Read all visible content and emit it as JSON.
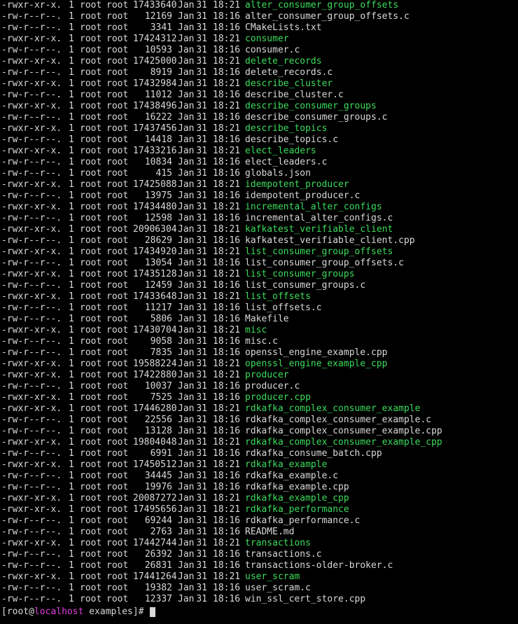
{
  "colors": {
    "background": "#000000",
    "text": "#d9d9d9",
    "executable": "#3ddc5c",
    "hostname": "#e040e0"
  },
  "listing": [
    {
      "perm": "-rwxr-xr-x.",
      "links": "1",
      "owner": "root",
      "group": "root",
      "size": "17433640",
      "month": "Jan",
      "day": "31",
      "time": "18:21",
      "name": "alter_consumer_group_offsets",
      "exec": true
    },
    {
      "perm": "-rw-r--r--.",
      "links": "1",
      "owner": "root",
      "group": "root",
      "size": "12169",
      "month": "Jan",
      "day": "31",
      "time": "18:16",
      "name": "alter_consumer_group_offsets.c",
      "exec": false
    },
    {
      "perm": "-rw-r--r--.",
      "links": "1",
      "owner": "root",
      "group": "root",
      "size": "3341",
      "month": "Jan",
      "day": "31",
      "time": "18:16",
      "name": "CMakeLists.txt",
      "exec": false
    },
    {
      "perm": "-rwxr-xr-x.",
      "links": "1",
      "owner": "root",
      "group": "root",
      "size": "17424312",
      "month": "Jan",
      "day": "31",
      "time": "18:21",
      "name": "consumer",
      "exec": true
    },
    {
      "perm": "-rw-r--r--.",
      "links": "1",
      "owner": "root",
      "group": "root",
      "size": "10593",
      "month": "Jan",
      "day": "31",
      "time": "18:16",
      "name": "consumer.c",
      "exec": false
    },
    {
      "perm": "-rwxr-xr-x.",
      "links": "1",
      "owner": "root",
      "group": "root",
      "size": "17425000",
      "month": "Jan",
      "day": "31",
      "time": "18:21",
      "name": "delete_records",
      "exec": true
    },
    {
      "perm": "-rw-r--r--.",
      "links": "1",
      "owner": "root",
      "group": "root",
      "size": "8919",
      "month": "Jan",
      "day": "31",
      "time": "18:16",
      "name": "delete_records.c",
      "exec": false
    },
    {
      "perm": "-rwxr-xr-x.",
      "links": "1",
      "owner": "root",
      "group": "root",
      "size": "17432984",
      "month": "Jan",
      "day": "31",
      "time": "18:21",
      "name": "describe_cluster",
      "exec": true
    },
    {
      "perm": "-rw-r--r--.",
      "links": "1",
      "owner": "root",
      "group": "root",
      "size": "11012",
      "month": "Jan",
      "day": "31",
      "time": "18:16",
      "name": "describe_cluster.c",
      "exec": false
    },
    {
      "perm": "-rwxr-xr-x.",
      "links": "1",
      "owner": "root",
      "group": "root",
      "size": "17438496",
      "month": "Jan",
      "day": "31",
      "time": "18:21",
      "name": "describe_consumer_groups",
      "exec": true
    },
    {
      "perm": "-rw-r--r--.",
      "links": "1",
      "owner": "root",
      "group": "root",
      "size": "16222",
      "month": "Jan",
      "day": "31",
      "time": "18:16",
      "name": "describe_consumer_groups.c",
      "exec": false
    },
    {
      "perm": "-rwxr-xr-x.",
      "links": "1",
      "owner": "root",
      "group": "root",
      "size": "17437456",
      "month": "Jan",
      "day": "31",
      "time": "18:21",
      "name": "describe_topics",
      "exec": true
    },
    {
      "perm": "-rw-r--r--.",
      "links": "1",
      "owner": "root",
      "group": "root",
      "size": "14418",
      "month": "Jan",
      "day": "31",
      "time": "18:16",
      "name": "describe_topics.c",
      "exec": false
    },
    {
      "perm": "-rwxr-xr-x.",
      "links": "1",
      "owner": "root",
      "group": "root",
      "size": "17433216",
      "month": "Jan",
      "day": "31",
      "time": "18:21",
      "name": "elect_leaders",
      "exec": true
    },
    {
      "perm": "-rw-r--r--.",
      "links": "1",
      "owner": "root",
      "group": "root",
      "size": "10834",
      "month": "Jan",
      "day": "31",
      "time": "18:16",
      "name": "elect_leaders.c",
      "exec": false
    },
    {
      "perm": "-rw-r--r--.",
      "links": "1",
      "owner": "root",
      "group": "root",
      "size": "415",
      "month": "Jan",
      "day": "31",
      "time": "18:16",
      "name": "globals.json",
      "exec": false
    },
    {
      "perm": "-rwxr-xr-x.",
      "links": "1",
      "owner": "root",
      "group": "root",
      "size": "17425088",
      "month": "Jan",
      "day": "31",
      "time": "18:21",
      "name": "idempotent_producer",
      "exec": true
    },
    {
      "perm": "-rw-r--r--.",
      "links": "1",
      "owner": "root",
      "group": "root",
      "size": "13975",
      "month": "Jan",
      "day": "31",
      "time": "18:16",
      "name": "idempotent_producer.c",
      "exec": false
    },
    {
      "perm": "-rwxr-xr-x.",
      "links": "1",
      "owner": "root",
      "group": "root",
      "size": "17434480",
      "month": "Jan",
      "day": "31",
      "time": "18:21",
      "name": "incremental_alter_configs",
      "exec": true
    },
    {
      "perm": "-rw-r--r--.",
      "links": "1",
      "owner": "root",
      "group": "root",
      "size": "12598",
      "month": "Jan",
      "day": "31",
      "time": "18:16",
      "name": "incremental_alter_configs.c",
      "exec": false
    },
    {
      "perm": "-rwxr-xr-x.",
      "links": "1",
      "owner": "root",
      "group": "root",
      "size": "20906304",
      "month": "Jan",
      "day": "31",
      "time": "18:21",
      "name": "kafkatest_verifiable_client",
      "exec": true
    },
    {
      "perm": "-rw-r--r--.",
      "links": "1",
      "owner": "root",
      "group": "root",
      "size": "28629",
      "month": "Jan",
      "day": "31",
      "time": "18:16",
      "name": "kafkatest_verifiable_client.cpp",
      "exec": false
    },
    {
      "perm": "-rwxr-xr-x.",
      "links": "1",
      "owner": "root",
      "group": "root",
      "size": "17434920",
      "month": "Jan",
      "day": "31",
      "time": "18:21",
      "name": "list_consumer_group_offsets",
      "exec": true
    },
    {
      "perm": "-rw-r--r--.",
      "links": "1",
      "owner": "root",
      "group": "root",
      "size": "13054",
      "month": "Jan",
      "day": "31",
      "time": "18:16",
      "name": "list_consumer_group_offsets.c",
      "exec": false
    },
    {
      "perm": "-rwxr-xr-x.",
      "links": "1",
      "owner": "root",
      "group": "root",
      "size": "17435128",
      "month": "Jan",
      "day": "31",
      "time": "18:21",
      "name": "list_consumer_groups",
      "exec": true
    },
    {
      "perm": "-rw-r--r--.",
      "links": "1",
      "owner": "root",
      "group": "root",
      "size": "12459",
      "month": "Jan",
      "day": "31",
      "time": "18:16",
      "name": "list_consumer_groups.c",
      "exec": false
    },
    {
      "perm": "-rwxr-xr-x.",
      "links": "1",
      "owner": "root",
      "group": "root",
      "size": "17433648",
      "month": "Jan",
      "day": "31",
      "time": "18:21",
      "name": "list_offsets",
      "exec": true
    },
    {
      "perm": "-rw-r--r--.",
      "links": "1",
      "owner": "root",
      "group": "root",
      "size": "11217",
      "month": "Jan",
      "day": "31",
      "time": "18:16",
      "name": "list_offsets.c",
      "exec": false
    },
    {
      "perm": "-rw-r--r--.",
      "links": "1",
      "owner": "root",
      "group": "root",
      "size": "5806",
      "month": "Jan",
      "day": "31",
      "time": "18:16",
      "name": "Makefile",
      "exec": false
    },
    {
      "perm": "-rwxr-xr-x.",
      "links": "1",
      "owner": "root",
      "group": "root",
      "size": "17430704",
      "month": "Jan",
      "day": "31",
      "time": "18:21",
      "name": "misc",
      "exec": true
    },
    {
      "perm": "-rw-r--r--.",
      "links": "1",
      "owner": "root",
      "group": "root",
      "size": "9058",
      "month": "Jan",
      "day": "31",
      "time": "18:16",
      "name": "misc.c",
      "exec": false
    },
    {
      "perm": "-rw-r--r--.",
      "links": "1",
      "owner": "root",
      "group": "root",
      "size": "7835",
      "month": "Jan",
      "day": "31",
      "time": "18:16",
      "name": "openssl_engine_example.cpp",
      "exec": false
    },
    {
      "perm": "-rwxr-xr-x.",
      "links": "1",
      "owner": "root",
      "group": "root",
      "size": "19588224",
      "month": "Jan",
      "day": "31",
      "time": "18:21",
      "name": "openssl_engine_example_cpp",
      "exec": true
    },
    {
      "perm": "-rwxr-xr-x.",
      "links": "1",
      "owner": "root",
      "group": "root",
      "size": "17422880",
      "month": "Jan",
      "day": "31",
      "time": "18:21",
      "name": "producer",
      "exec": true
    },
    {
      "perm": "-rw-r--r--.",
      "links": "1",
      "owner": "root",
      "group": "root",
      "size": "10037",
      "month": "Jan",
      "day": "31",
      "time": "18:16",
      "name": "producer.c",
      "exec": false
    },
    {
      "perm": "-rwxr-xr-x.",
      "links": "1",
      "owner": "root",
      "group": "root",
      "size": "7525",
      "month": "Jan",
      "day": "31",
      "time": "18:16",
      "name": "producer.cpp",
      "exec": true
    },
    {
      "perm": "-rwxr-xr-x.",
      "links": "1",
      "owner": "root",
      "group": "root",
      "size": "17446280",
      "month": "Jan",
      "day": "31",
      "time": "18:21",
      "name": "rdkafka_complex_consumer_example",
      "exec": true
    },
    {
      "perm": "-rw-r--r--.",
      "links": "1",
      "owner": "root",
      "group": "root",
      "size": "22556",
      "month": "Jan",
      "day": "31",
      "time": "18:16",
      "name": "rdkafka_complex_consumer_example.c",
      "exec": false
    },
    {
      "perm": "-rw-r--r--.",
      "links": "1",
      "owner": "root",
      "group": "root",
      "size": "13128",
      "month": "Jan",
      "day": "31",
      "time": "18:16",
      "name": "rdkafka_complex_consumer_example.cpp",
      "exec": false
    },
    {
      "perm": "-rwxr-xr-x.",
      "links": "1",
      "owner": "root",
      "group": "root",
      "size": "19804048",
      "month": "Jan",
      "day": "31",
      "time": "18:21",
      "name": "rdkafka_complex_consumer_example_cpp",
      "exec": true
    },
    {
      "perm": "-rw-r--r--.",
      "links": "1",
      "owner": "root",
      "group": "root",
      "size": "6991",
      "month": "Jan",
      "day": "31",
      "time": "18:16",
      "name": "rdkafka_consume_batch.cpp",
      "exec": false
    },
    {
      "perm": "-rwxr-xr-x.",
      "links": "1",
      "owner": "root",
      "group": "root",
      "size": "17450512",
      "month": "Jan",
      "day": "31",
      "time": "18:21",
      "name": "rdkafka_example",
      "exec": true
    },
    {
      "perm": "-rw-r--r--.",
      "links": "1",
      "owner": "root",
      "group": "root",
      "size": "34445",
      "month": "Jan",
      "day": "31",
      "time": "18:16",
      "name": "rdkafka_example.c",
      "exec": false
    },
    {
      "perm": "-rw-r--r--.",
      "links": "1",
      "owner": "root",
      "group": "root",
      "size": "19976",
      "month": "Jan",
      "day": "31",
      "time": "18:16",
      "name": "rdkafka_example.cpp",
      "exec": false
    },
    {
      "perm": "-rwxr-xr-x.",
      "links": "1",
      "owner": "root",
      "group": "root",
      "size": "20087272",
      "month": "Jan",
      "day": "31",
      "time": "18:21",
      "name": "rdkafka_example_cpp",
      "exec": true
    },
    {
      "perm": "-rwxr-xr-x.",
      "links": "1",
      "owner": "root",
      "group": "root",
      "size": "17495656",
      "month": "Jan",
      "day": "31",
      "time": "18:21",
      "name": "rdkafka_performance",
      "exec": true
    },
    {
      "perm": "-rw-r--r--.",
      "links": "1",
      "owner": "root",
      "group": "root",
      "size": "69244",
      "month": "Jan",
      "day": "31",
      "time": "18:16",
      "name": "rdkafka_performance.c",
      "exec": false
    },
    {
      "perm": "-rw-r--r--.",
      "links": "1",
      "owner": "root",
      "group": "root",
      "size": "2763",
      "month": "Jan",
      "day": "31",
      "time": "18:16",
      "name": "README.md",
      "exec": false
    },
    {
      "perm": "-rwxr-xr-x.",
      "links": "1",
      "owner": "root",
      "group": "root",
      "size": "17442744",
      "month": "Jan",
      "day": "31",
      "time": "18:21",
      "name": "transactions",
      "exec": true
    },
    {
      "perm": "-rw-r--r--.",
      "links": "1",
      "owner": "root",
      "group": "root",
      "size": "26392",
      "month": "Jan",
      "day": "31",
      "time": "18:16",
      "name": "transactions.c",
      "exec": false
    },
    {
      "perm": "-rw-r--r--.",
      "links": "1",
      "owner": "root",
      "group": "root",
      "size": "26831",
      "month": "Jan",
      "day": "31",
      "time": "18:16",
      "name": "transactions-older-broker.c",
      "exec": false
    },
    {
      "perm": "-rwxr-xr-x.",
      "links": "1",
      "owner": "root",
      "group": "root",
      "size": "17441264",
      "month": "Jan",
      "day": "31",
      "time": "18:21",
      "name": "user_scram",
      "exec": true
    },
    {
      "perm": "-rw-r--r--.",
      "links": "1",
      "owner": "root",
      "group": "root",
      "size": "19382",
      "month": "Jan",
      "day": "31",
      "time": "18:16",
      "name": "user_scram.c",
      "exec": false
    },
    {
      "perm": "-rw-r--r--.",
      "links": "1",
      "owner": "root",
      "group": "root",
      "size": "12337",
      "month": "Jan",
      "day": "31",
      "time": "18:16",
      "name": "win_ssl_cert_store.cpp",
      "exec": false
    }
  ],
  "prompt": {
    "open": "[",
    "user": "root",
    "at": "@",
    "host": "localhost",
    "space": " ",
    "cwd": "examples",
    "close": "]# "
  }
}
